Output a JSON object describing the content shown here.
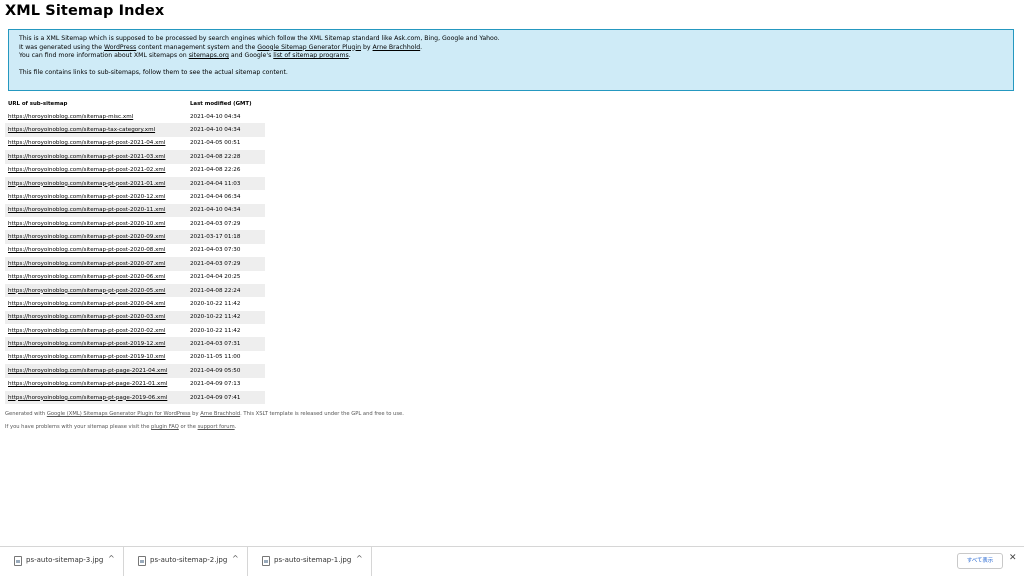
{
  "page_title": "XML Sitemap Index",
  "intro": {
    "line1": "This is a XML Sitemap which is supposed to be processed by search engines which follow the XML Sitemap standard like Ask.com, Bing, Google and Yahoo.",
    "line2_pre": "It was generated using the ",
    "line2_link1": "WordPress",
    "line2_mid": " content management system and the ",
    "line2_link2": "Google Sitemap Generator Plugin",
    "line2_by": " by ",
    "line2_link3": "Arne Brachhold",
    "line2_end": ".",
    "line3_pre": "You can find more information about XML sitemaps on ",
    "line3_link1": "sitemaps.org",
    "line3_mid": " and Google's ",
    "line3_link2": "list of sitemap programs",
    "line3_end": ".",
    "line4": "This file contains links to sub-sitemaps, follow them to see the actual sitemap content."
  },
  "table": {
    "headers": {
      "url": "URL of sub-sitemap",
      "modified": "Last modified (GMT)"
    },
    "rows": [
      {
        "url": "https://horoyoinoblog.com/sitemap-misc.xml",
        "modified": "2021-04-10 04:34"
      },
      {
        "url": "https://horoyoinoblog.com/sitemap-tax-category.xml",
        "modified": "2021-04-10 04:34"
      },
      {
        "url": "https://horoyoinoblog.com/sitemap-pt-post-2021-04.xml",
        "modified": "2021-04-05 00:51"
      },
      {
        "url": "https://horoyoinoblog.com/sitemap-pt-post-2021-03.xml",
        "modified": "2021-04-08 22:28"
      },
      {
        "url": "https://horoyoinoblog.com/sitemap-pt-post-2021-02.xml",
        "modified": "2021-04-08 22:26"
      },
      {
        "url": "https://horoyoinoblog.com/sitemap-pt-post-2021-01.xml",
        "modified": "2021-04-04 11:03"
      },
      {
        "url": "https://horoyoinoblog.com/sitemap-pt-post-2020-12.xml",
        "modified": "2021-04-04 06:34"
      },
      {
        "url": "https://horoyoinoblog.com/sitemap-pt-post-2020-11.xml",
        "modified": "2021-04-10 04:34"
      },
      {
        "url": "https://horoyoinoblog.com/sitemap-pt-post-2020-10.xml",
        "modified": "2021-04-03 07:29"
      },
      {
        "url": "https://horoyoinoblog.com/sitemap-pt-post-2020-09.xml",
        "modified": "2021-03-17 01:18"
      },
      {
        "url": "https://horoyoinoblog.com/sitemap-pt-post-2020-08.xml",
        "modified": "2021-04-03 07:30"
      },
      {
        "url": "https://horoyoinoblog.com/sitemap-pt-post-2020-07.xml",
        "modified": "2021-04-03 07:29"
      },
      {
        "url": "https://horoyoinoblog.com/sitemap-pt-post-2020-06.xml",
        "modified": "2021-04-04 20:25"
      },
      {
        "url": "https://horoyoinoblog.com/sitemap-pt-post-2020-05.xml",
        "modified": "2021-04-08 22:24"
      },
      {
        "url": "https://horoyoinoblog.com/sitemap-pt-post-2020-04.xml",
        "modified": "2020-10-22 11:42"
      },
      {
        "url": "https://horoyoinoblog.com/sitemap-pt-post-2020-03.xml",
        "modified": "2020-10-22 11:42"
      },
      {
        "url": "https://horoyoinoblog.com/sitemap-pt-post-2020-02.xml",
        "modified": "2020-10-22 11:42"
      },
      {
        "url": "https://horoyoinoblog.com/sitemap-pt-post-2019-12.xml",
        "modified": "2021-04-03 07:31"
      },
      {
        "url": "https://horoyoinoblog.com/sitemap-pt-post-2019-10.xml",
        "modified": "2020-11-05 11:00"
      },
      {
        "url": "https://horoyoinoblog.com/sitemap-pt-page-2021-04.xml",
        "modified": "2021-04-09 05:50"
      },
      {
        "url": "https://horoyoinoblog.com/sitemap-pt-page-2021-01.xml",
        "modified": "2021-04-09 07:13"
      },
      {
        "url": "https://horoyoinoblog.com/sitemap-pt-page-2019-06.xml",
        "modified": "2021-04-09 07:41"
      }
    ]
  },
  "footer": {
    "line1_pre": "Generated with ",
    "line1_link1": "Google (XML) Sitemaps Generator Plugin for WordPress",
    "line1_by": " by ",
    "line1_link2": "Arne Brachhold",
    "line1_end": ". This XSLT template is released under the GPL and free to use.",
    "line2_pre": "If you have problems with your sitemap please visit the ",
    "line2_link1": "plugin FAQ",
    "line2_mid": " or the ",
    "line2_link2": "support forum",
    "line2_end": "."
  },
  "download_bar": {
    "items": [
      {
        "name": "ps-auto-sitemap-3.jpg",
        "icon": "image-file-icon"
      },
      {
        "name": "ps-auto-sitemap-2.jpg",
        "icon": "image-file-icon"
      },
      {
        "name": "ps-auto-sitemap-1.jpg",
        "icon": "image-file-icon"
      }
    ],
    "caret": "^",
    "show_all_label": "すべて表示",
    "close_label": "✕"
  },
  "colors": {
    "intro_bg": "#cfebf7",
    "intro_border": "#2598c0",
    "row_stripe": "#eeeeee",
    "show_all_text": "#1a5fd0"
  }
}
